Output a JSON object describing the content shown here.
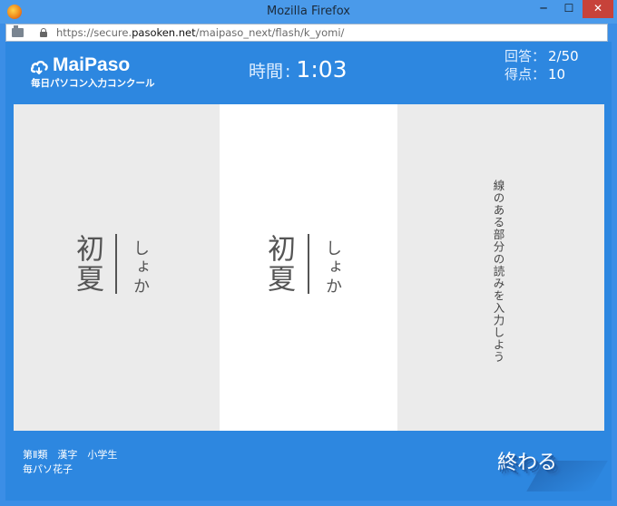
{
  "window": {
    "title": "Mozilla Firefox",
    "controls": {
      "minimize": "─",
      "maximize": "☐",
      "close": "✕"
    }
  },
  "address_bar": {
    "url_prefix": "https://secure.",
    "url_host": "pasoken.net",
    "url_path": "/maipaso_next/flash/k_yomi/"
  },
  "header": {
    "brand": "MaiPaso",
    "tagline": "毎日パソコン入力コンクール",
    "timer_label": "時間",
    "timer_sep": ":",
    "timer_value": "1:03",
    "answers_label": "回答：",
    "answers_value": "2/50",
    "score_label": "得点：",
    "score_value": "10"
  },
  "question": {
    "kanji": "初夏",
    "reading": "しょか"
  },
  "answer": {
    "kanji": "初夏",
    "reading": "しょか"
  },
  "instruction": "線のある部分の読みを入力しよう",
  "footer": {
    "category": "第Ⅱ類　漢字　小学生",
    "user": "毎パソ花子",
    "end_button": "終わる"
  },
  "colors": {
    "background": "#2d87e0",
    "panel_gray": "#ebebeb",
    "panel_white": "#ffffff",
    "text_dark": "#555555"
  }
}
